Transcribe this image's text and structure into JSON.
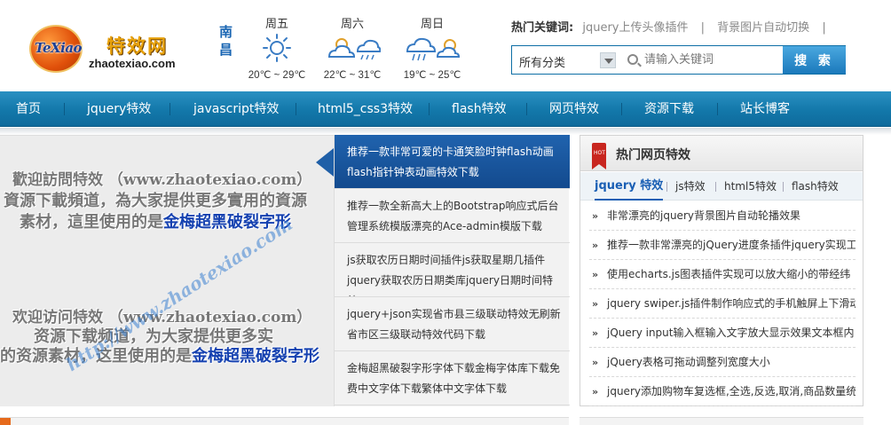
{
  "logo": {
    "badge_text": "TeXiao",
    "cn_name": "特效网",
    "url": "zhaotexiao.com"
  },
  "weather": {
    "city_line1": "南",
    "city_line2": "昌",
    "days": [
      {
        "name": "周五",
        "icon": "sunny-icon",
        "temp": "20℃ ~ 29℃"
      },
      {
        "name": "周六",
        "icon": "partly-cloudy-icon",
        "icon2": "cloudy-rain-icon",
        "temp": "22℃ ~ 31℃"
      },
      {
        "name": "周日",
        "icon": "rain-cloud-icon",
        "icon2": "partly-cloudy-icon",
        "temp": "19℃ ~ 25℃"
      }
    ]
  },
  "hot_keywords": {
    "title": "热门关键词:",
    "items": [
      "jquery上传头像插件",
      "背景图片自动切换"
    ],
    "separator": "|"
  },
  "search": {
    "category": "所有分类",
    "placeholder": "请输入关键词",
    "button": "搜 索"
  },
  "nav": {
    "items": [
      "首页",
      "jquery特效",
      "javascript特效",
      "html5_css3特效",
      "flash特效",
      "网页特效",
      "资源下载",
      "站长博客"
    ]
  },
  "slider": {
    "block1": {
      "line1": "歡迎訪問特效  （www.zhaotexiao.com）",
      "line2": "資源下載頻道，為大家提供更多實用的資源",
      "line3a": "素材，這里使用的是",
      "line3b": "金梅超黑破裂字形"
    },
    "block2": {
      "line1": "欢迎访问特效  （www.zhaotexiao.com）",
      "line2": "资源下载频道，为大家提供更多实",
      "line3a": "的资源素材，这里使用的是",
      "line3b": "金梅超黑破裂字形"
    },
    "watermark": "http://www.zhaotexiao.com"
  },
  "slide_list": [
    "推荐一款非常可爱的卡通笑脸时钟flash动画flash指针钟表动画特效下载",
    "推荐一款全新高大上的Bootstrap响应式后台管理系统模版漂亮的Ace-admin模版下载",
    "js获取农历日期时间插件js获取星期几插件jquery获取农历日期类库jquery日期时间特效",
    "jquery+json实现省市县三级联动特效无刷新省市区三级联动特效代码下载",
    "金梅超黑破裂字形字体下载金梅字体库下载免费中文字体下载繁体中文字体下载"
  ],
  "panel": {
    "title": "热门网页特效",
    "icon_text": "HOT",
    "tabs": [
      "jquery 特效",
      "js特效",
      "html5特效",
      "flash特效"
    ],
    "items": [
      "非常漂亮的jquery背景图片自动轮播效果",
      "推荐一款非常漂亮的jQuery进度条插件jquery实现工",
      "使用echarts.js图表插件实现可以放大缩小的带经纬",
      "jquery swiper.js插件制作响应式的手机触屏上下滑动",
      "jQuery input输入框输入文字放大显示效果文本框内",
      "jQuery表格可拖动调整列宽度大小",
      "jquery添加购物车复选框,全选,反选,取消,商品数量统"
    ],
    "bullet": "»"
  }
}
